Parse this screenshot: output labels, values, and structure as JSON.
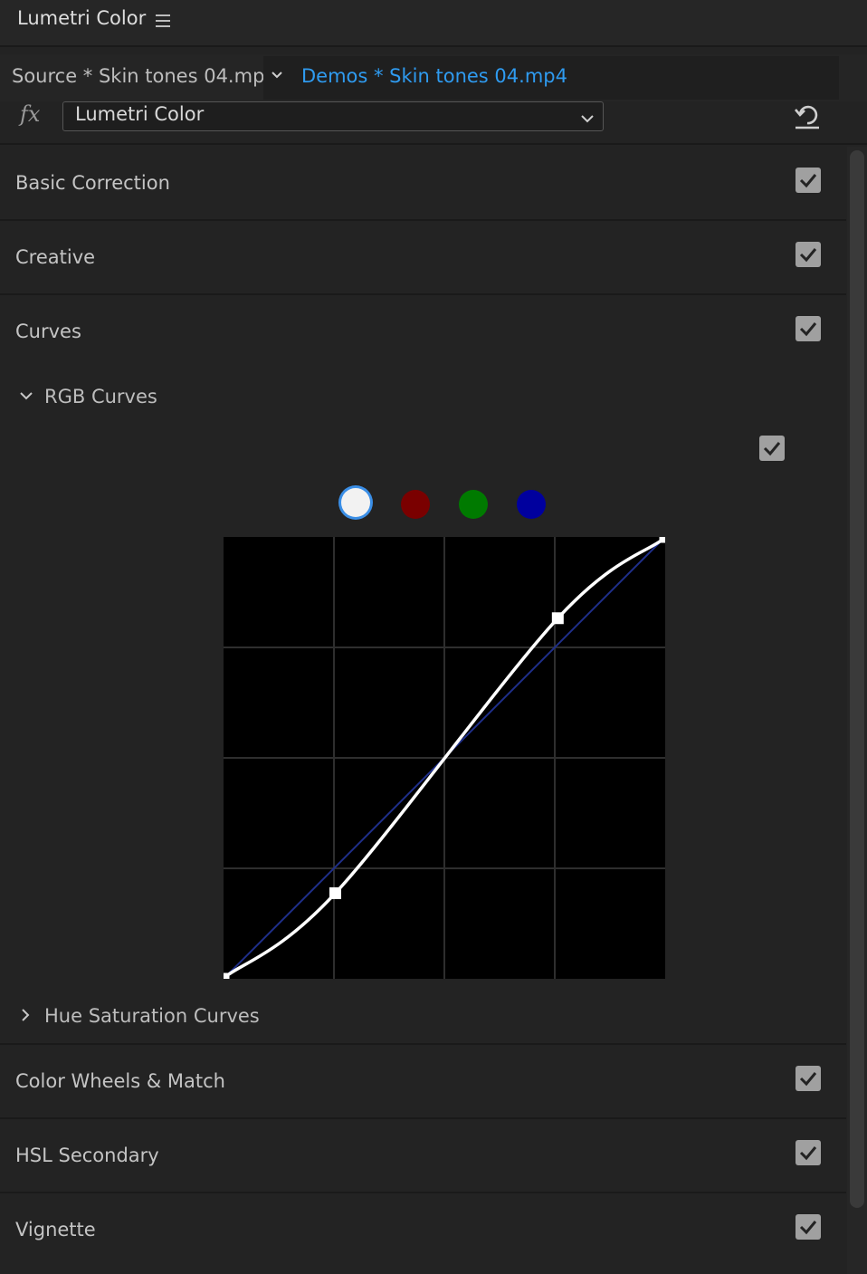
{
  "panel": {
    "title": "Lumetri Color"
  },
  "tabs": {
    "source": "Source * Skin tones 04.mp4",
    "sequence": "Demos * Skin tones 04.mp4"
  },
  "effect": {
    "fx_label": "fx",
    "selected": "Lumetri Color"
  },
  "sections": [
    {
      "label": "Basic Correction",
      "enabled": true
    },
    {
      "label": "Creative",
      "enabled": true
    },
    {
      "label": "Curves",
      "enabled": true
    },
    {
      "label": "Color Wheels & Match",
      "enabled": true
    },
    {
      "label": "HSL Secondary",
      "enabled": true
    },
    {
      "label": "Vignette",
      "enabled": true
    }
  ],
  "curves": {
    "rgb_curves": {
      "label": "RGB Curves",
      "expanded": true,
      "enabled": true
    },
    "hue_saturation_curves": {
      "label": "Hue Saturation Curves",
      "expanded": false
    },
    "channels": [
      {
        "name": "luma",
        "color": "#f2f2f2",
        "selected": true
      },
      {
        "name": "red",
        "color": "#7a0000",
        "selected": false
      },
      {
        "name": "green",
        "color": "#007a00",
        "selected": false
      },
      {
        "name": "blue",
        "color": "#00009e",
        "selected": false
      }
    ],
    "points": [
      {
        "input": 0.0,
        "output": 0.0
      },
      {
        "input": 0.25,
        "output": 0.19
      },
      {
        "input": 0.76,
        "output": 0.82
      },
      {
        "input": 1.0,
        "output": 1.0
      }
    ]
  },
  "colors": {
    "accent": "#2f9bf0",
    "panel_bg": "#232323",
    "selection_ring": "#3a8ee6"
  }
}
